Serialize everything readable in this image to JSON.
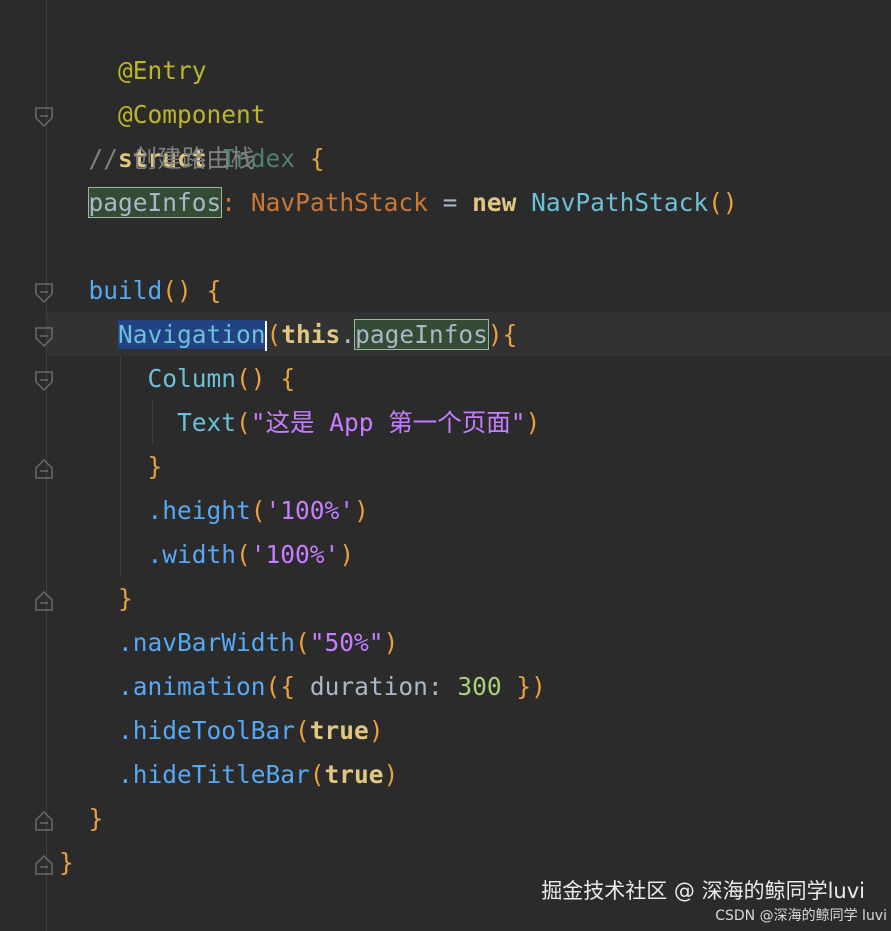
{
  "code": {
    "l1_entry": "@Entry",
    "l2_component": "@Component",
    "l3_struct_kw": "struct",
    "l3_struct_name": "Index",
    "l3_brace": "{",
    "l4_comment": "// 创建路由栈",
    "l5_var": "pageInfos",
    "l5_colon": ":",
    "l5_type": "NavPathStack",
    "l5_eq": "=",
    "l5_new": "new",
    "l5_ctor": "NavPathStack",
    "l5_parens": "()",
    "l7_build": "build",
    "l7_parens": "()",
    "l7_brace": "{",
    "l8_nav": "Navigation",
    "l8_open": "(",
    "l8_this": "this",
    "l8_dot": ".",
    "l8_arg": "pageInfos",
    "l8_close": ")",
    "l8_brace": "{",
    "l9_column": "Column",
    "l9_parens": "()",
    "l9_brace": "{",
    "l10_text": "Text",
    "l10_open": "(",
    "l10_string": "\"这是 App 第一个页面\"",
    "l10_close": ")",
    "l11_brace": "}",
    "l12_height": ".height",
    "l12_open": "(",
    "l12_value": "'100%'",
    "l12_close": ")",
    "l13_width": ".width",
    "l13_open": "(",
    "l13_value": "'100%'",
    "l13_close": ")",
    "l14_brace": "}",
    "l15_method": ".navBarWidth",
    "l15_open": "(",
    "l15_value": "\"50%\"",
    "l15_close": ")",
    "l16_method": ".animation",
    "l16_open": "({",
    "l16_key": "duration",
    "l16_colon": ":",
    "l16_value": "300",
    "l16_close": "})",
    "l17_method": ".hideToolBar",
    "l17_open": "(",
    "l17_value": "true",
    "l17_close": ")",
    "l18_method": ".hideTitleBar",
    "l18_open": "(",
    "l18_value": "true",
    "l18_close": ")",
    "l19_brace": "}",
    "l20_brace": "}"
  },
  "watermark": {
    "primary": "掘金技术社区 @ 深海的鲸同学luvi",
    "secondary": "CSDN @深海的鲸同学 luvi"
  },
  "colors": {
    "background": "#2b2b2b",
    "keyword": "#e0c880",
    "annotation": "#bbb529",
    "function": "#56a8f5",
    "string": "#a8d179",
    "selection": "#214283"
  }
}
